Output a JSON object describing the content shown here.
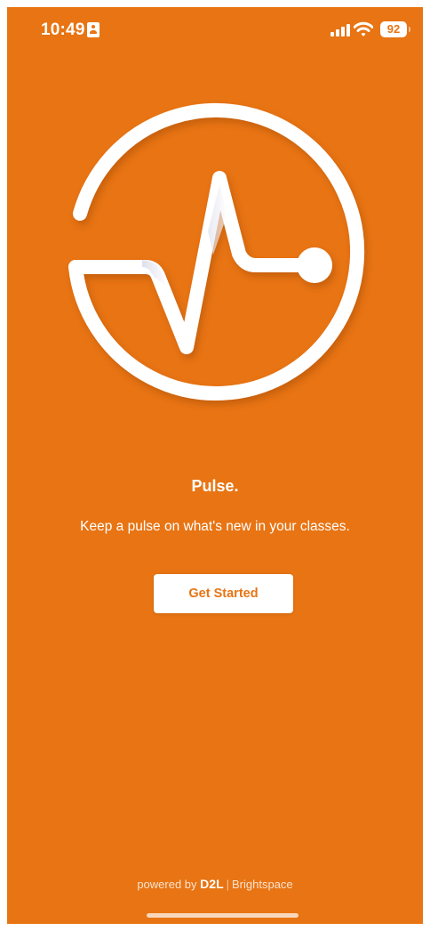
{
  "status_bar": {
    "time": "10:49",
    "battery_level": "92",
    "contact_icon": "contact-card-icon",
    "signal_icon": "cellular-signal-icon",
    "wifi_icon": "wifi-icon",
    "battery_icon": "battery-icon"
  },
  "logo": {
    "icon": "pulse-heartbeat-icon"
  },
  "main": {
    "title": "Pulse.",
    "tagline": "Keep a pulse on what's new in your classes.",
    "get_started_label": "Get Started"
  },
  "footer": {
    "powered_by": "powered by",
    "brand": "D2L",
    "divider": "|",
    "product": "Brightspace"
  },
  "colors": {
    "background": "#E87413",
    "accent": "#E87413",
    "foreground": "#FFFFFF"
  }
}
